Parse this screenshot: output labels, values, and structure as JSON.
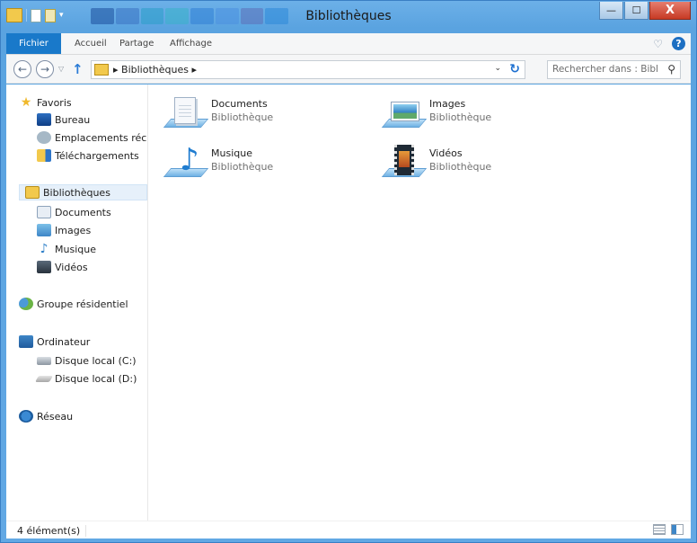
{
  "window": {
    "title": "Bibliothèques",
    "minimize_glyph": "—",
    "maximize_glyph": "☐",
    "close_glyph": "X"
  },
  "quick_access": {
    "dropdown_glyph": "▾"
  },
  "ribbon": {
    "tabs": [
      {
        "label": "Fichier"
      },
      {
        "label": "Accueil"
      },
      {
        "label": "Partage"
      },
      {
        "label": "Affichage"
      }
    ],
    "expand_glyph": "♡",
    "help_glyph": "?"
  },
  "navigation": {
    "back_glyph": "←",
    "forward_glyph": "→",
    "recent_glyph": "▽",
    "up_glyph": "↑",
    "address_path": "▸ Bibliothèques ▸",
    "address_dropdown_glyph": "⌄",
    "refresh_glyph": "↻",
    "search_placeholder": "Rechercher dans : Bibli...",
    "search_glyph": "⚲"
  },
  "sidebar": {
    "favorites": {
      "label": "Favoris",
      "icon": "star-icon"
    },
    "favorite_items": [
      {
        "label": "Bureau",
        "icon": "desktop-icon"
      },
      {
        "label": "Emplacements récen",
        "icon": "recent-places-icon"
      },
      {
        "label": "Téléchargements",
        "icon": "downloads-icon"
      }
    ],
    "libraries": {
      "label": "Bibliothèques",
      "icon": "libraries-icon"
    },
    "library_items": [
      {
        "label": "Documents",
        "icon": "documents-icon"
      },
      {
        "label": "Images",
        "icon": "pictures-icon"
      },
      {
        "label": "Musique",
        "icon": "music-icon"
      },
      {
        "label": "Vidéos",
        "icon": "videos-icon"
      }
    ],
    "homegroup": {
      "label": "Groupe résidentiel",
      "icon": "homegroup-icon"
    },
    "computer": {
      "label": "Ordinateur",
      "icon": "computer-icon"
    },
    "drives": [
      {
        "label": "Disque local (C:)",
        "icon": "hard-drive-icon"
      },
      {
        "label": "Disque local (D:)",
        "icon": "hard-drive-icon"
      }
    ],
    "network": {
      "label": "Réseau",
      "icon": "network-icon"
    }
  },
  "libraries": [
    {
      "name": "Documents",
      "type": "Bibliothèque",
      "icon": "documents-library-icon"
    },
    {
      "name": "Images",
      "type": "Bibliothèque",
      "icon": "pictures-library-icon"
    },
    {
      "name": "Musique",
      "type": "Bibliothèque",
      "icon": "music-library-icon"
    },
    {
      "name": "Vidéos",
      "type": "Bibliothèque",
      "icon": "videos-library-icon"
    }
  ],
  "status": {
    "item_count": "4 élément(s)"
  },
  "colors": {
    "file_tab": "#1979ca",
    "title_bar": "#62a8e4",
    "close_button": "#c73a24",
    "selected_nav": "#e6f0fa"
  }
}
